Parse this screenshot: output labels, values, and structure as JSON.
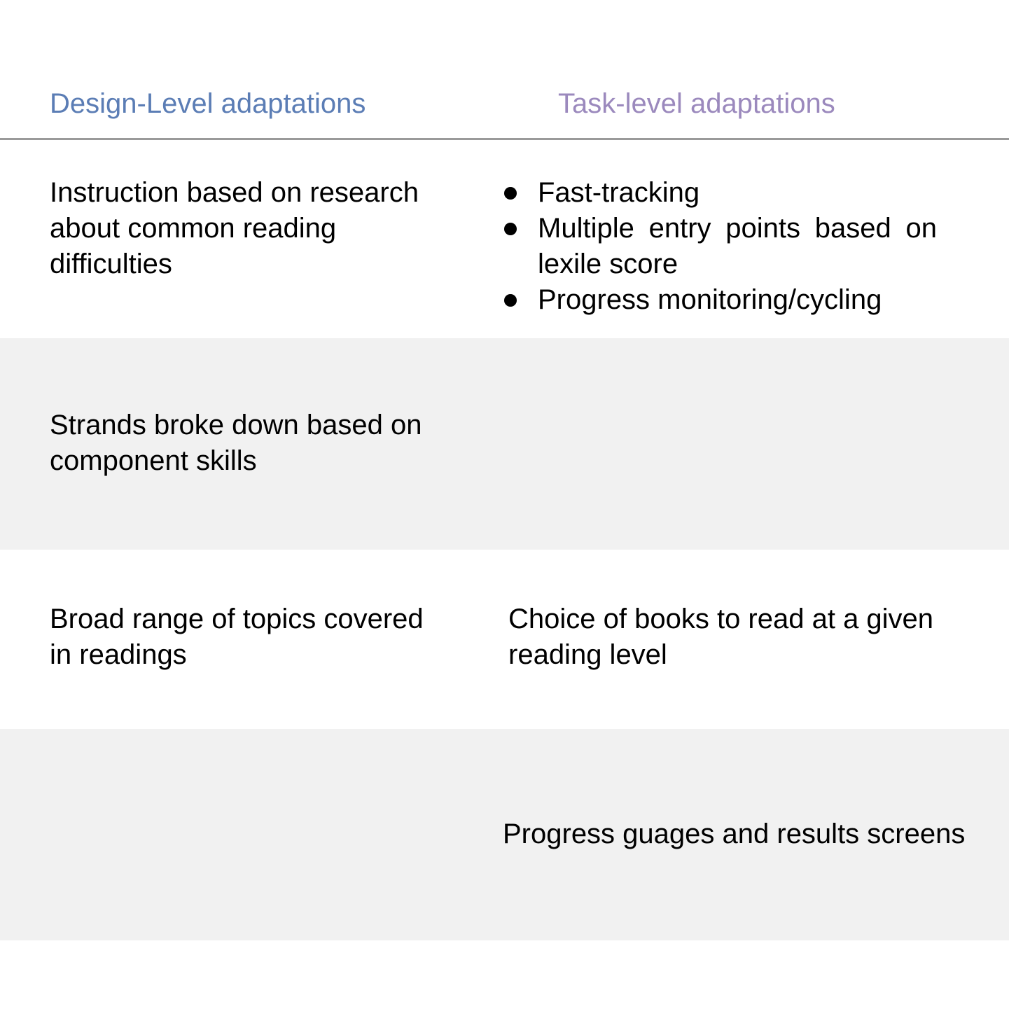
{
  "header": {
    "design_label": "Design-Level adaptations",
    "task_label": "Task-level adaptations"
  },
  "colors": {
    "design_header": "#5b7db5",
    "task_header": "#9b89bd",
    "row_shade": "#f1f1f1",
    "divider": "#9a9a9a"
  },
  "rows": [
    {
      "design": "Instruction based on research about common reading difficulties",
      "task_list": [
        "Fast-tracking",
        "Multiple entry points based on lexile score",
        "Progress monitoring/cycling"
      ]
    },
    {
      "design": "Strands broke down based on component skills",
      "task": ""
    },
    {
      "design": "Broad range of topics covered in readings",
      "task": "Choice of books to read at a given reading level"
    },
    {
      "design": "",
      "task": "Progress guages and results screens"
    }
  ]
}
